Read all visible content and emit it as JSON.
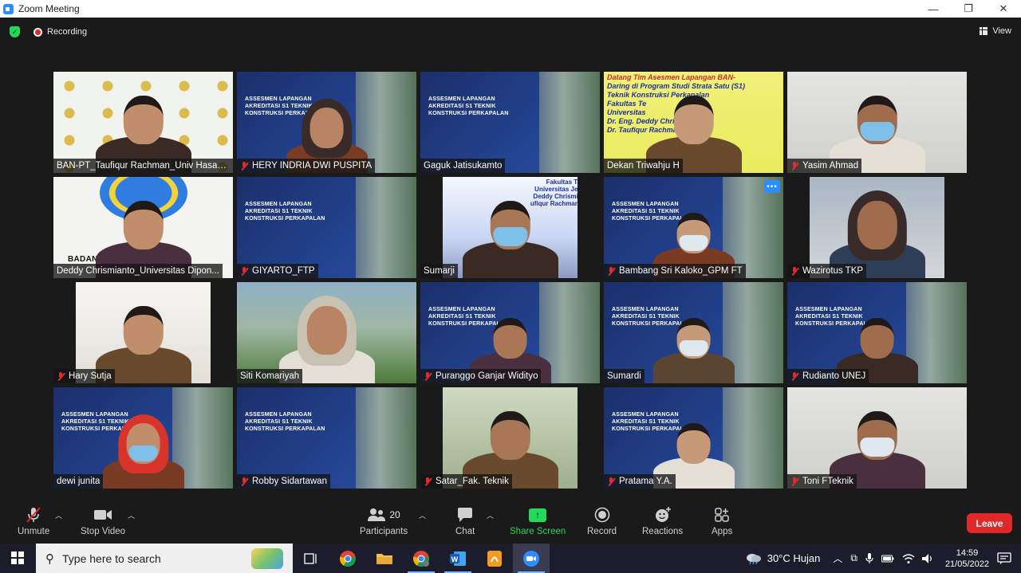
{
  "window": {
    "title": "Zoom Meeting",
    "minimize_glyph": "—",
    "maximize_glyph": "❐",
    "close_glyph": "✕"
  },
  "topbar": {
    "recording_label": "Recording",
    "view_label": "View"
  },
  "participants": [
    {
      "name": "BAN-PT_Taufiqur Rachman_Univ Hasan...",
      "muted": false,
      "bg": "ban"
    },
    {
      "name": "HERY INDRIA DWI PUSPITA",
      "muted": true,
      "bg": "slide"
    },
    {
      "name": "Gaguk Jatisukamto",
      "muted": false,
      "bg": "slide"
    },
    {
      "name": "Dekan Triwahju H",
      "muted": false,
      "bg": "yellow",
      "active": true
    },
    {
      "name": "Yasim Ahmad",
      "muted": true,
      "bg": "wall"
    },
    {
      "name": "Deddy Chrismianto_Universitas Dipon...",
      "muted": false,
      "bg": "white"
    },
    {
      "name": "GIYARTO_FTP",
      "muted": true,
      "bg": "slide"
    },
    {
      "name": "Sumarji",
      "muted": false,
      "bg": "poster"
    },
    {
      "name": "Bambang Sri Kaloko_GPM FT",
      "muted": true,
      "bg": "slide"
    },
    {
      "name": "Wazirotus TKP",
      "muted": true,
      "bg": "office"
    },
    {
      "name": "Hary Sutja",
      "muted": true,
      "bg": "room"
    },
    {
      "name": "Siti Komariyah",
      "muted": false,
      "bg": "campus"
    },
    {
      "name": "Puranggo Ganjar Widityo",
      "muted": true,
      "bg": "slide"
    },
    {
      "name": "Sumardi",
      "muted": false,
      "bg": "slide"
    },
    {
      "name": "Rudianto UNEJ",
      "muted": true,
      "bg": "slide"
    },
    {
      "name": "dewi junita",
      "muted": false,
      "bg": "slide"
    },
    {
      "name": "Robby Sidartawan",
      "muted": true,
      "bg": "slide"
    },
    {
      "name": "Satar_Fak. Teknik",
      "muted": true,
      "bg": "green"
    },
    {
      "name": "Pratama Y.A.",
      "muted": true,
      "bg": "slide"
    },
    {
      "name": "Toni FTeknik",
      "muted": true,
      "bg": "wall"
    }
  ],
  "slide_text": "ASSESMEN LAPANGAN\nAKREDITASI S1 TEKNIK\nKONSTRUKSI PERKAPALAN",
  "yellow_banner": {
    "line1": "Datang Tim Asesmen Lapangan BAN-",
    "line2": "Daring di Program Studi Strata Satu (S1)",
    "line3": "Teknik Konstruksi Perkapalan",
    "line4": "Fakultas Te",
    "line5": "Universitas",
    "line6": "Dr. Eng. Deddy Chris",
    "line7": "Dr. Taufiqur Rachma"
  },
  "ban_logo_text": "BADAN AK     I NASIONAL",
  "poster_text": "Fakultas Teknik\nUniversitas Jember\nDeddy Chrismianto,\nufiqur Rachman, S.T.",
  "controls": {
    "unmute": "Unmute",
    "stop_video": "Stop Video",
    "participants": "Participants",
    "participants_count": "20",
    "chat": "Chat",
    "share_screen": "Share Screen",
    "record": "Record",
    "reactions": "Reactions",
    "apps": "Apps",
    "leave": "Leave"
  },
  "taskbar": {
    "search_placeholder": "Type here to search",
    "weather": "30°C  Hujan",
    "time": "14:59",
    "date": "21/05/2022"
  },
  "colors": {
    "accent": "#2d8cff",
    "share_green": "#23d959",
    "leave_red": "#e02828",
    "active_outline": "#f5e64a"
  }
}
